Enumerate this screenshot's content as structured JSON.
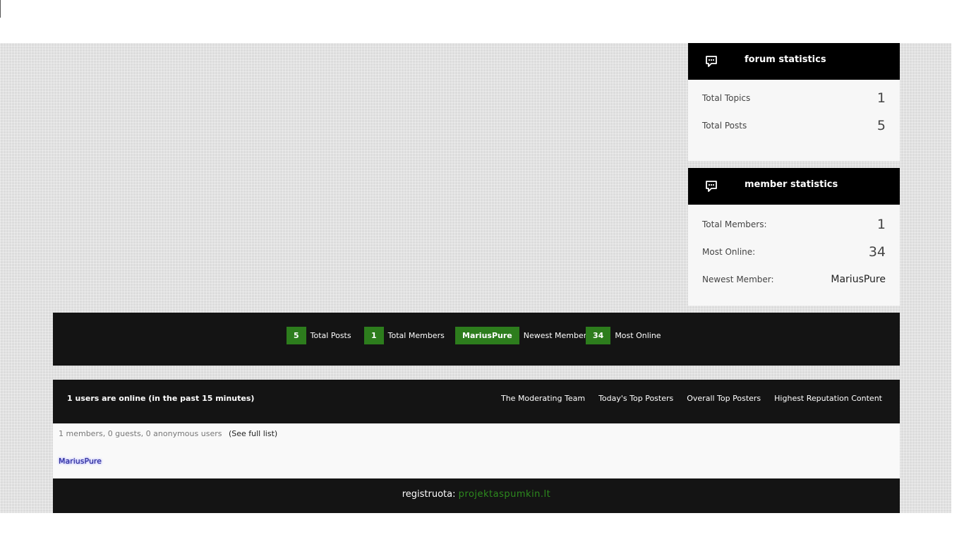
{
  "forum_statistics": {
    "title": "forum statistics",
    "icon": "chat-bubble-icon",
    "rows": [
      {
        "label": "Total Topics",
        "value": "1"
      },
      {
        "label": "Total Posts",
        "value": "5"
      }
    ]
  },
  "member_statistics": {
    "title": "member statistics",
    "icon": "chat-bubble-icon",
    "rows": [
      {
        "label": "Total Members:",
        "value": "1"
      },
      {
        "label": "Most Online:",
        "value": "34"
      },
      {
        "label": "Newest Member:",
        "value": "MariusPure"
      }
    ]
  },
  "stats_bar": [
    {
      "value": "5",
      "label": "Total Posts"
    },
    {
      "value": "1",
      "label": "Total Members"
    },
    {
      "value": "MariusPure",
      "label": "Newest Member"
    },
    {
      "value": "34",
      "label": "Most Online"
    }
  ],
  "online": {
    "title": "1 users are online (in the past 15 minutes)",
    "links": [
      "The Moderating Team",
      "Today's Top Posters",
      "Overall Top Posters",
      "Highest Reputation Content"
    ],
    "counts": "1 members, 0 guests, 0 anonymous users",
    "see_full": "(See full list)",
    "users": [
      "MariusPure"
    ]
  },
  "footer": {
    "label": "registruota:",
    "link": "projektaspumkin.lt"
  },
  "colors": {
    "accent_green": "#2d7d1d",
    "dark_bar": "#141414",
    "panel_head": "#000000"
  }
}
